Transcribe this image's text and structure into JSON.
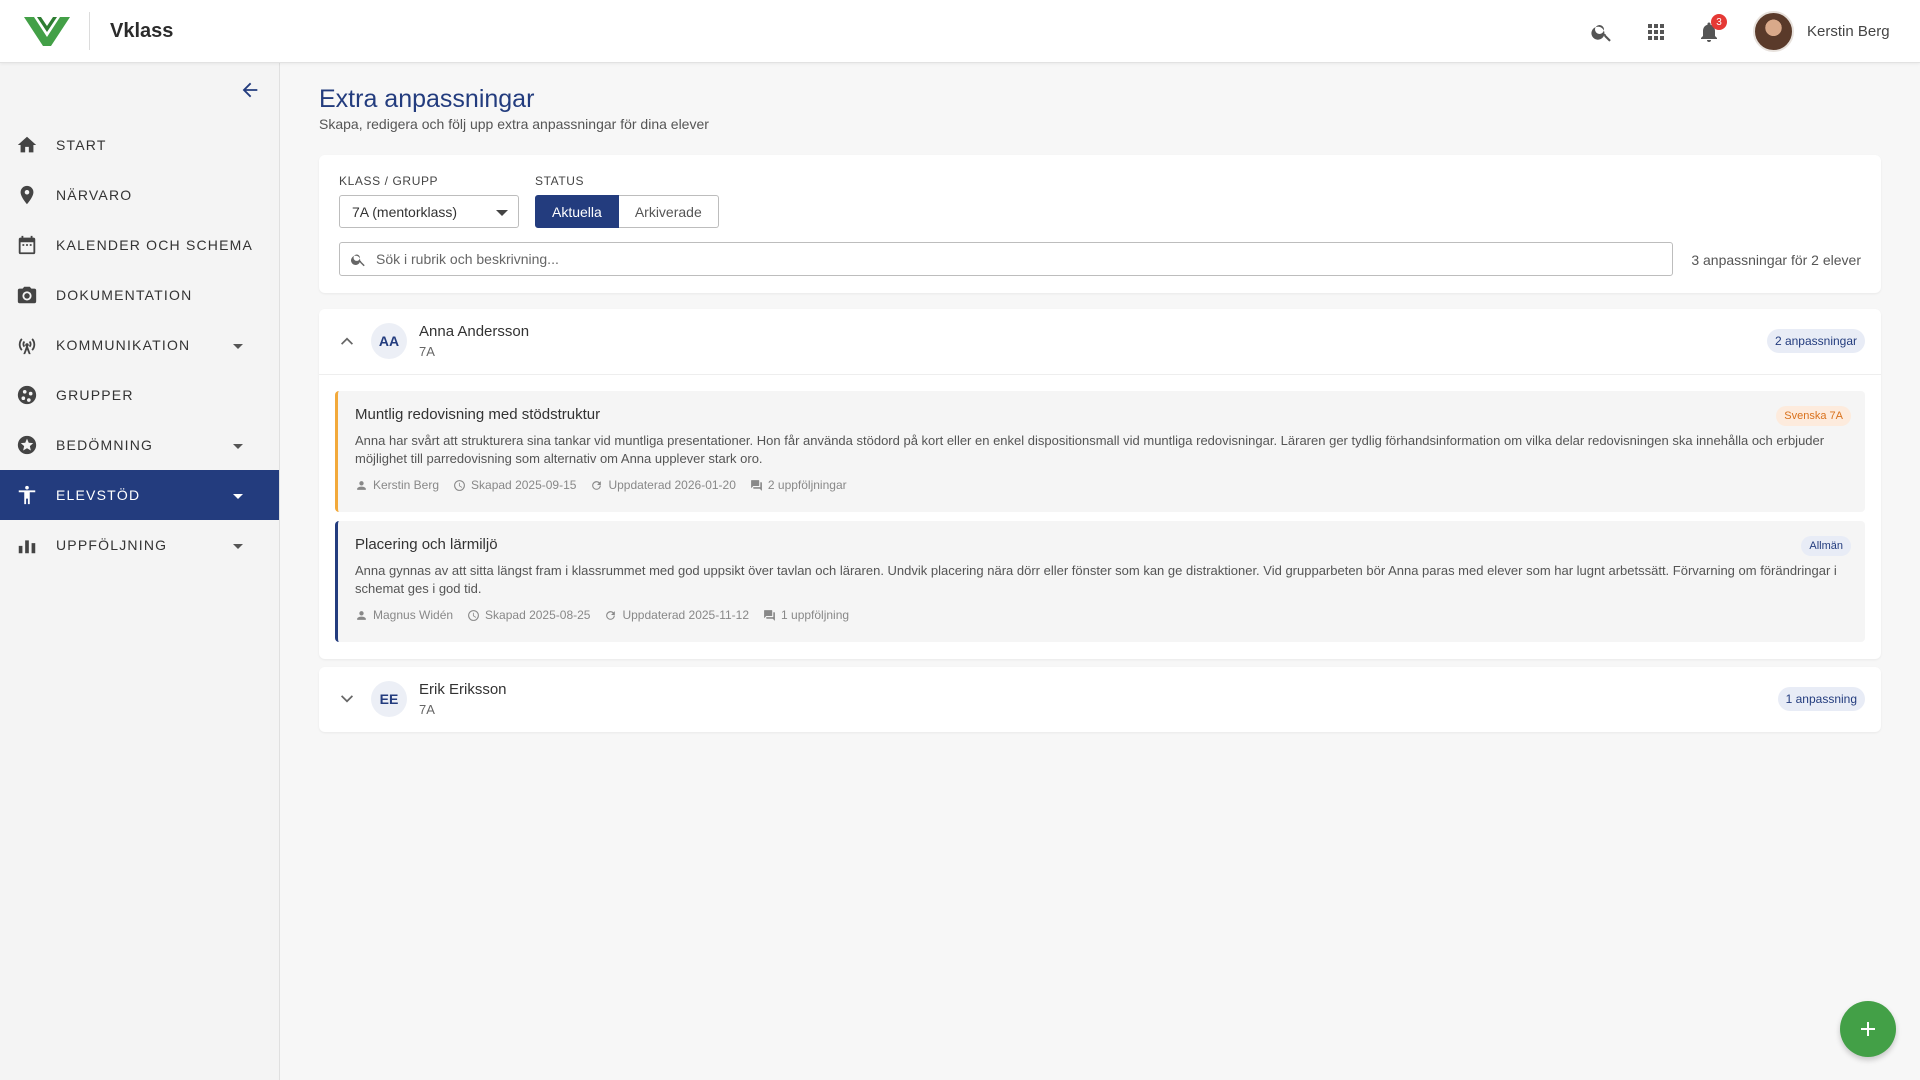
{
  "app": {
    "brand": "Vklass",
    "brand_color": "#233c7e",
    "logo_color": "#43a047"
  },
  "topbar": {
    "icons": [
      "search-icon",
      "apps-grid-icon",
      "bell-icon"
    ],
    "notification_count": "3",
    "user_name": "Kerstin Berg"
  },
  "sidebar": {
    "items": [
      {
        "label": "START",
        "icon": "home-icon",
        "has_caret": false,
        "active": false
      },
      {
        "label": "NÄRVARO",
        "icon": "location-pin-icon",
        "has_caret": false,
        "active": false
      },
      {
        "label": "KALENDER OCH SCHEMA",
        "icon": "calendar-icon",
        "has_caret": false,
        "active": false
      },
      {
        "label": "DOKUMENTATION",
        "icon": "camera-icon",
        "has_caret": false,
        "active": false
      },
      {
        "label": "KOMMUNIKATION",
        "icon": "broadcast-icon",
        "has_caret": true,
        "active": false
      },
      {
        "label": "GRUPPER",
        "icon": "groups-icon",
        "has_caret": false,
        "active": false
      },
      {
        "label": "BEDÖMNING",
        "icon": "star-icon",
        "has_caret": true,
        "active": false
      },
      {
        "label": "ELEVSTÖD",
        "icon": "accessibility-icon",
        "has_caret": true,
        "active": true
      },
      {
        "label": "UPPFÖLJNING",
        "icon": "bar-chart-icon",
        "has_caret": true,
        "active": false
      }
    ]
  },
  "page": {
    "title": "Extra anpassningar",
    "subtitle": "Skapa, redigera och följ upp extra anpassningar för dina elever"
  },
  "filters": {
    "class_label": "KLASS / GRUPP",
    "class_value": "7A (mentorklass)",
    "status_label": "STATUS",
    "status_options": [
      "Aktuella",
      "Arkiverade"
    ],
    "status_selected": "Aktuella",
    "search_placeholder": "Sök i rubrik och beskrivning...",
    "result_count": "3 anpassningar för 2 elever"
  },
  "students": [
    {
      "initials": "AA",
      "name": "Anna Andersson",
      "class": "7A",
      "count_label": "2 anpassningar",
      "expanded": true,
      "adjustments": [
        {
          "title": "Muntlig redovisning med stödstruktur",
          "tag": "Svenska 7A",
          "tag_color": "#d9711c",
          "description": "Anna har svårt att strukturera sina tankar vid muntliga presentationer. Hon får använda stödord på kort eller en enkel dispositionsmall vid muntliga redovisningar. Läraren ger tydlig förhandsinformation om vilka delar redovisningen ska innehålla och erbjuder möjlighet till parredovisning som alternativ om Anna upplever stark oro.",
          "author": "Kerstin Berg",
          "created": "Skapad 2025-09-15",
          "updated": "Uppdaterad 2026-01-20",
          "followups": "2 uppföljningar"
        },
        {
          "title": "Placering och lärmiljö",
          "tag": "Allmän",
          "tag_color": "#233c7e",
          "description": "Anna gynnas av att sitta längst fram i klassrummet med god uppsikt över tavlan och läraren. Undvik placering nära dörr eller fönster som kan ge distraktioner. Vid grupparbeten bör Anna paras med elever som har lugnt arbetssätt. Förvarning om förändringar i schemat ges i god tid.",
          "author": "Magnus Widén",
          "created": "Skapad 2025-08-25",
          "updated": "Uppdaterad 2025-11-12",
          "followups": "1 uppföljning"
        }
      ]
    },
    {
      "initials": "EE",
      "name": "Erik Eriksson",
      "class": "7A",
      "count_label": "1 anpassning",
      "expanded": false
    }
  ]
}
